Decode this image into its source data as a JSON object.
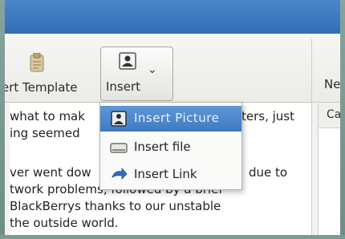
{
  "toolbar": {
    "insert_template_label": "ert Template",
    "insert_label": "Insert",
    "right_label": "Ne"
  },
  "right_panel": {
    "header": "Cat"
  },
  "editor": {
    "lines": [
      "what to mak",
      "ing seemed",
      "ver went dow",
      "twork problems, followed by a brief",
      " BlackBerrys thanks to our unstable",
      " the outside world."
    ],
    "line1_tail": "ters, just",
    "line3_tail": "due to"
  },
  "insert_menu": {
    "items": [
      {
        "label": "Insert Picture",
        "icon": "person-icon",
        "selected": true
      },
      {
        "label": "Insert file",
        "icon": "file-icon",
        "selected": false
      },
      {
        "label": "Insert Link",
        "icon": "link-arrow-icon",
        "selected": false
      }
    ]
  },
  "colors": {
    "titlebar": "#3a78c0",
    "menu_highlight": "#4f88cc",
    "window_bg": "#f2f2f0"
  }
}
